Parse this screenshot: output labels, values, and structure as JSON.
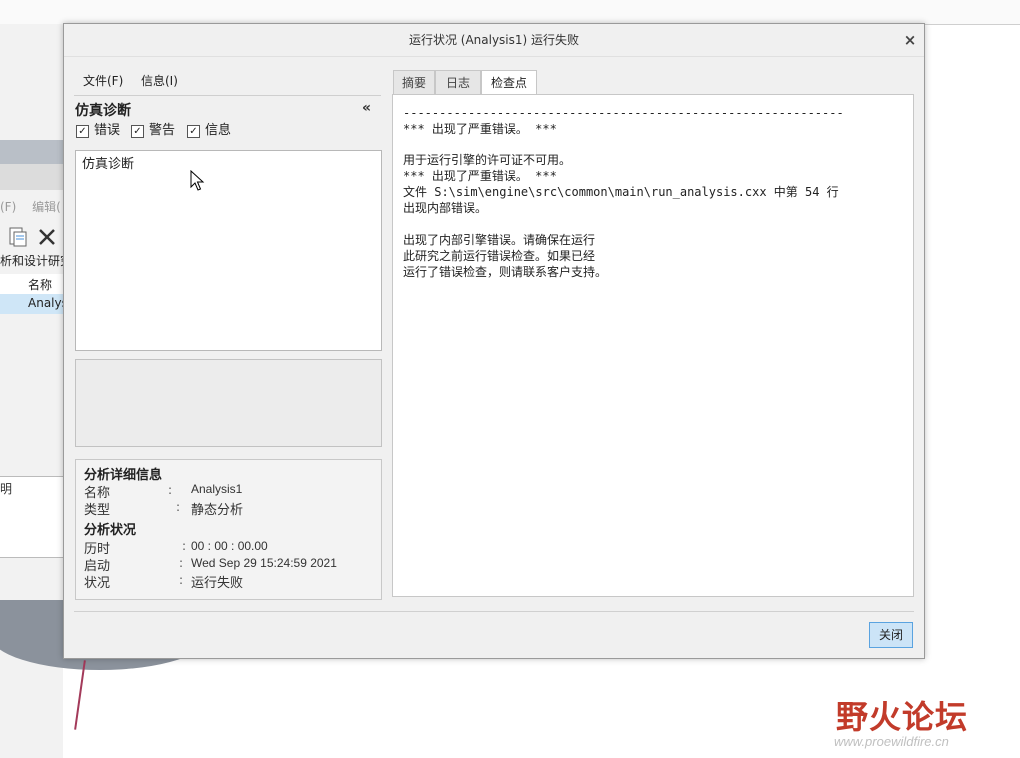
{
  "background_app": {
    "menu_file": "(F)",
    "menu_edit": "编辑(",
    "toolbar_label": "析和设计研究",
    "table_header": "名称",
    "table_row_value": "Analys",
    "lower_label": "明"
  },
  "dialog": {
    "title": "运行状况 (Analysis1) 运行失败",
    "menu": {
      "file": "文件(F)",
      "info": "信息(I)"
    },
    "left_panel": {
      "title": "仿真诊断",
      "collapse": "«",
      "filters": [
        {
          "label": "错误",
          "checked": true
        },
        {
          "label": "警告",
          "checked": true
        },
        {
          "label": "信息",
          "checked": true
        }
      ],
      "tree_root": "仿真诊断"
    },
    "details": {
      "section_info": "分析详细信息",
      "name_label": "名称",
      "name_value": "Analysis1",
      "type_label": "类型",
      "type_value": "静态分析",
      "section_status": "分析状况",
      "elapsed_label": "历时",
      "elapsed_value": "00 : 00 : 00.00",
      "start_label": "启动",
      "start_value": "Wed Sep 29 15:24:59 2021",
      "status_label": "状况",
      "status_value": "运行失败",
      "colon": ":"
    },
    "tabs": [
      {
        "label": "摘要",
        "active": false
      },
      {
        "label": "日志",
        "active": false
      },
      {
        "label": "检查点",
        "active": true
      }
    ],
    "log_lines": [
      "-------------------------------------------------------------",
      "*** 出现了严重错误。 ***",
      "",
      "用于运行引擎的许可证不可用。",
      "*** 出现了严重错误。 ***",
      "文件 S:\\sim\\engine\\src\\common\\main\\run_analysis.cxx 中第 54 行",
      "出现内部错误。",
      "",
      "出现了内部引擎错误。请确保在运行",
      "此研究之前运行错误检查。如果已经",
      "运行了错误检查，则请联系客户支持。"
    ],
    "close_button": "关闭",
    "close_icon": "×"
  },
  "watermark": {
    "text": "野火论坛",
    "url": "www.proewildfire.cn"
  },
  "colors": {
    "accent_button": "#cce4f7",
    "accent_border": "#5aa3e0",
    "watermark": "#c23b2a"
  }
}
